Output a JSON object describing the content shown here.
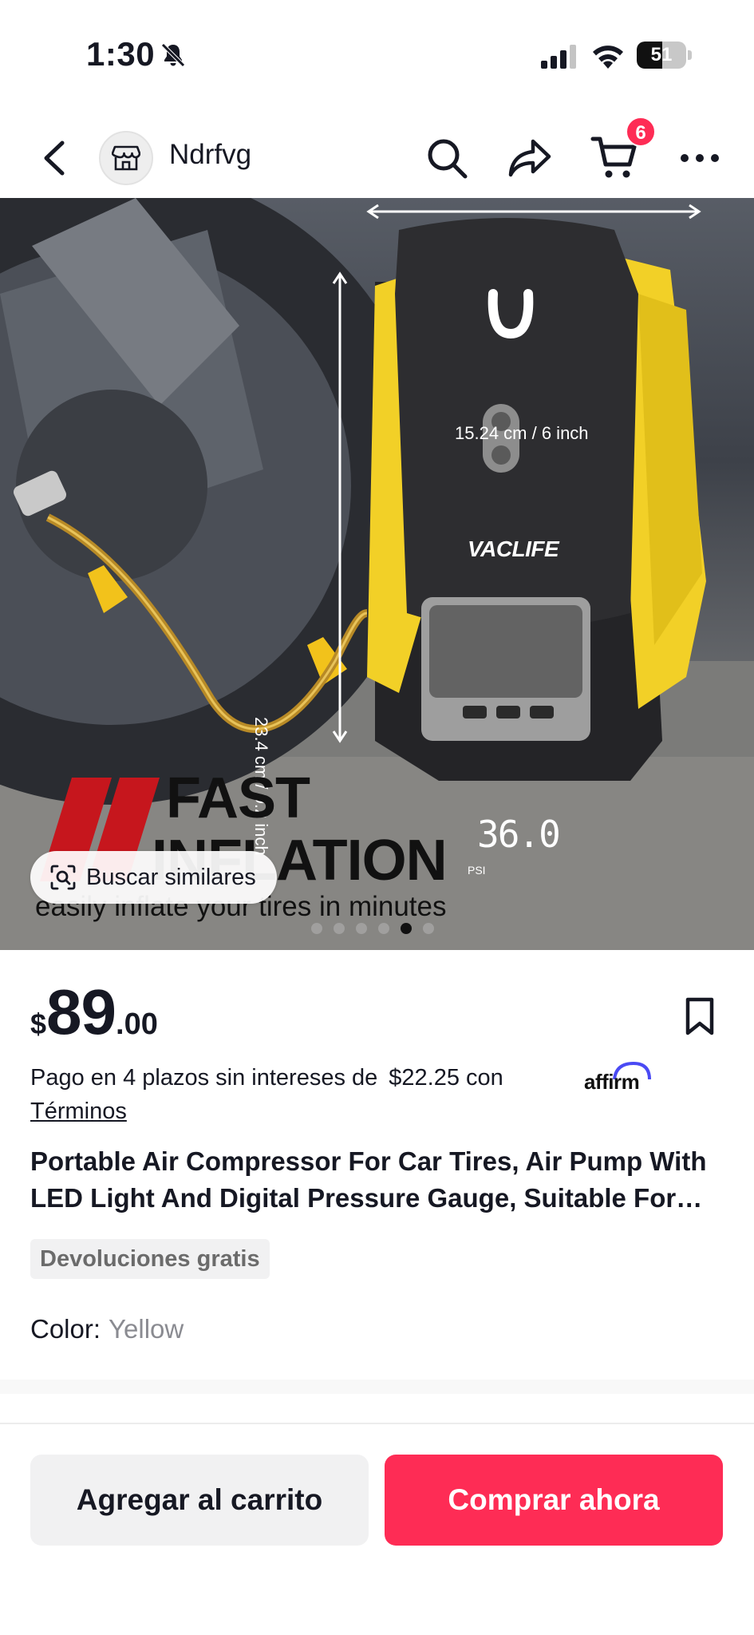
{
  "status_bar": {
    "time": "1:30",
    "battery_level": "51",
    "icons": [
      "bell-slash-icon",
      "cellular-signal-icon",
      "wifi-icon",
      "battery-icon"
    ]
  },
  "header": {
    "shop_name": "Ndrfvg",
    "cart_count": "6",
    "icons": [
      "chevron-left-icon",
      "store-icon",
      "search-icon",
      "share-icon",
      "cart-icon",
      "more-icon"
    ]
  },
  "product_image": {
    "dimension_width": "15.24 cm / 6 inch",
    "dimension_height": "23.4 cm / 9.2 inch",
    "brand": "VACLIFE",
    "display_value": "36.0",
    "display_unit": "PSI",
    "headline_line1": "FAST",
    "headline_line2": "INFLATION",
    "subline": "easily inflate your tires in minutes",
    "image_count": 6,
    "active_image_index": 4
  },
  "search_similar": {
    "label": "Buscar similares",
    "icon": "image-search-icon"
  },
  "price": {
    "currency": "$",
    "integer": "89",
    "decimal": ".00"
  },
  "installments": {
    "text": "Pago en 4 plazos sin intereses de",
    "amount": "$22.25 con",
    "provider": "affirm",
    "terms_label": "Términos"
  },
  "product": {
    "title": "Portable Air Compressor For Car Tires, Air Pump With LED Light And Digital Pressure Gauge, Suitable For Car Tires",
    "returns_badge": "Devoluciones gratis",
    "color_label": "Color:",
    "color_value": "Yellow"
  },
  "actions": {
    "add_to_cart": "Agregar al carrito",
    "buy_now": "Comprar ahora"
  },
  "colors": {
    "accent": "#fe2c55",
    "text": "#161823",
    "muted": "#8a8b91",
    "badge_bg": "#f1f1f2",
    "product_yellow": "#f2d027"
  }
}
